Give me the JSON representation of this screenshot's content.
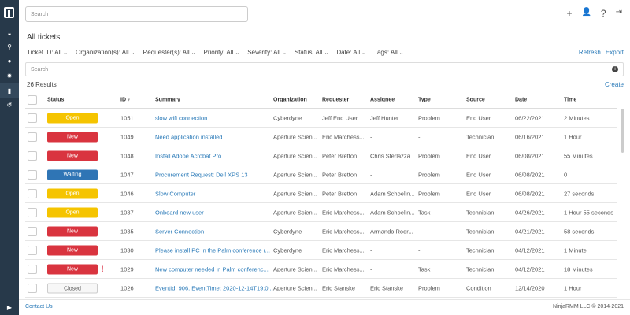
{
  "topbar": {
    "search_placeholder": "Search"
  },
  "page": {
    "title": "All tickets",
    "results": "26 Results",
    "refresh": "Refresh",
    "export": "Export",
    "create": "Create",
    "search_placeholder": "Search"
  },
  "filters": [
    {
      "label": "Ticket ID:",
      "value": "All"
    },
    {
      "label": "Organization(s):",
      "value": "All"
    },
    {
      "label": "Requester(s):",
      "value": "All"
    },
    {
      "label": "Priority:",
      "value": "All"
    },
    {
      "label": "Severity:",
      "value": "All"
    },
    {
      "label": "Status:",
      "value": "All"
    },
    {
      "label": "Date:",
      "value": "All"
    },
    {
      "label": "Tags:",
      "value": "All"
    }
  ],
  "columns": [
    "Status",
    "ID",
    "Summary",
    "Organization",
    "Requester",
    "Assignee",
    "Type",
    "Source",
    "Date",
    "Time"
  ],
  "id_sort_indicator": "▾",
  "status_colors": {
    "Open": "#f5c400",
    "New": "#d9343f",
    "Waiting": "#2f75b5",
    "Closed": "#f7f7f7"
  },
  "rows": [
    {
      "status": "Open",
      "id": "1051",
      "summary": "slow wifi connection",
      "org": "Cyberdyne",
      "requester": "Jeff End User",
      "assignee": "Jeff Hunter",
      "type": "Problem",
      "source": "End User",
      "date": "06/22/2021",
      "time": "2 Minutes"
    },
    {
      "status": "New",
      "id": "1049",
      "summary": "Need application installed",
      "org": "Aperture Scien...",
      "requester": "Eric Marchess...",
      "assignee": "-",
      "type": "-",
      "source": "Technician",
      "date": "06/16/2021",
      "time": "1 Hour"
    },
    {
      "status": "New",
      "id": "1048",
      "summary": "Install Adobe Acrobat Pro",
      "org": "Aperture Scien...",
      "requester": "Peter Bretton",
      "assignee": "Chris Sferlazza",
      "type": "Problem",
      "source": "End User",
      "date": "06/08/2021",
      "time": "55 Minutes"
    },
    {
      "status": "Waiting",
      "id": "1047",
      "summary": "Procurement Request: Dell XPS 13",
      "org": "Aperture Scien...",
      "requester": "Peter Bretton",
      "assignee": "-",
      "type": "Problem",
      "source": "End User",
      "date": "06/08/2021",
      "time": "0"
    },
    {
      "status": "Open",
      "id": "1046",
      "summary": "Slow Computer",
      "org": "Aperture Scien...",
      "requester": "Peter Bretton",
      "assignee": "Adam Schoelln...",
      "type": "Problem",
      "source": "End User",
      "date": "06/08/2021",
      "time": "27 seconds"
    },
    {
      "status": "Open",
      "id": "1037",
      "summary": "Onboard new user",
      "org": "Aperture Scien...",
      "requester": "Eric Marchess...",
      "assignee": "Adam Schoelln...",
      "type": "Task",
      "source": "Technician",
      "date": "04/26/2021",
      "time": "1 Hour 55 seconds"
    },
    {
      "status": "New",
      "id": "1035",
      "summary": "Server Connection",
      "org": "Cyberdyne",
      "requester": "Eric Marchess...",
      "assignee": "Armando Rodr...",
      "type": "-",
      "source": "Technician",
      "date": "04/21/2021",
      "time": "58 seconds"
    },
    {
      "status": "New",
      "id": "1030",
      "summary": "Please install PC in the Palm conference r...",
      "org": "Cyberdyne",
      "requester": "Eric Marchess...",
      "assignee": "-",
      "type": "-",
      "source": "Technician",
      "date": "04/12/2021",
      "time": "1 Minute"
    },
    {
      "status": "New",
      "id": "1029",
      "summary": "New computer needed in Palm conferenc...",
      "org": "Aperture Scien...",
      "requester": "Eric Marchess...",
      "assignee": "-",
      "type": "Task",
      "source": "Technician",
      "date": "04/12/2021",
      "time": "18 Minutes",
      "flag": "!"
    },
    {
      "status": "Closed",
      "id": "1026",
      "summary": "EventId: 906. EventTime: 2020-12-14T19:0...",
      "org": "Aperture Scien...",
      "requester": "Eric Stanske",
      "assignee": "Eric Stanske",
      "type": "Problem",
      "source": "Condition",
      "date": "12/14/2020",
      "time": "1 Hour"
    }
  ],
  "footer": {
    "contact": "Contact Us",
    "copyright": "NinjaRMM LLC © 2014-2021"
  }
}
